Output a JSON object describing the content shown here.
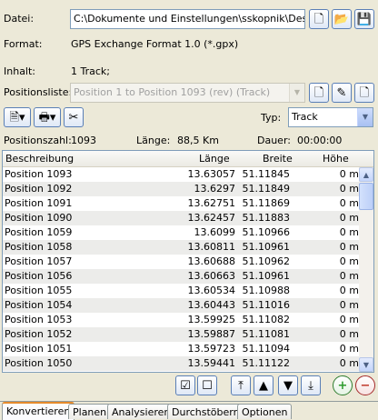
{
  "file": {
    "label": "Datei:",
    "path": "C:\\Dokumente und Einstellungen\\sskopnik\\Desktop\\DC"
  },
  "format": {
    "label": "Format:",
    "value": "GPS Exchange Format 1.0 (*.gpx)"
  },
  "content": {
    "label": "Inhalt:",
    "value": "1 Track;"
  },
  "poslist": {
    "label": "Positionsliste:",
    "value": "Position 1 to Position 1093 (rev) (Track)"
  },
  "type": {
    "label": "Typ:",
    "value": "Track"
  },
  "stats": {
    "count_label": "Positionszahl:",
    "count": "1093",
    "length_label": "Länge:",
    "length": "88,5 Km",
    "duration_label": "Dauer:",
    "duration": "00:00:00"
  },
  "table": {
    "headers": [
      "Beschreibung",
      "Länge",
      "Breite",
      "Höhe"
    ],
    "rows": [
      [
        "Position 1093",
        "13.63057",
        "51.11845",
        "0 m"
      ],
      [
        "Position 1092",
        "13.6297",
        "51.11849",
        "0 m"
      ],
      [
        "Position 1091",
        "13.62751",
        "51.11869",
        "0 m"
      ],
      [
        "Position 1090",
        "13.62457",
        "51.11883",
        "0 m"
      ],
      [
        "Position 1059",
        "13.6099",
        "51.10966",
        "0 m"
      ],
      [
        "Position 1058",
        "13.60811",
        "51.10961",
        "0 m"
      ],
      [
        "Position 1057",
        "13.60688",
        "51.10962",
        "0 m"
      ],
      [
        "Position 1056",
        "13.60663",
        "51.10961",
        "0 m"
      ],
      [
        "Position 1055",
        "13.60534",
        "51.10988",
        "0 m"
      ],
      [
        "Position 1054",
        "13.60443",
        "51.11016",
        "0 m"
      ],
      [
        "Position 1053",
        "13.59925",
        "51.11082",
        "0 m"
      ],
      [
        "Position 1052",
        "13.59887",
        "51.11081",
        "0 m"
      ],
      [
        "Position 1051",
        "13.59723",
        "51.11094",
        "0 m"
      ],
      [
        "Position 1050",
        "13.59441",
        "51.11122",
        "0 m"
      ]
    ]
  },
  "tabs": [
    "Konvertieren",
    "Planen",
    "Analysieren",
    "Durchstöbern",
    "Optionen"
  ],
  "colors": {
    "tab_highlight": "#e68b2c",
    "window_bg": "#ece9d8"
  }
}
